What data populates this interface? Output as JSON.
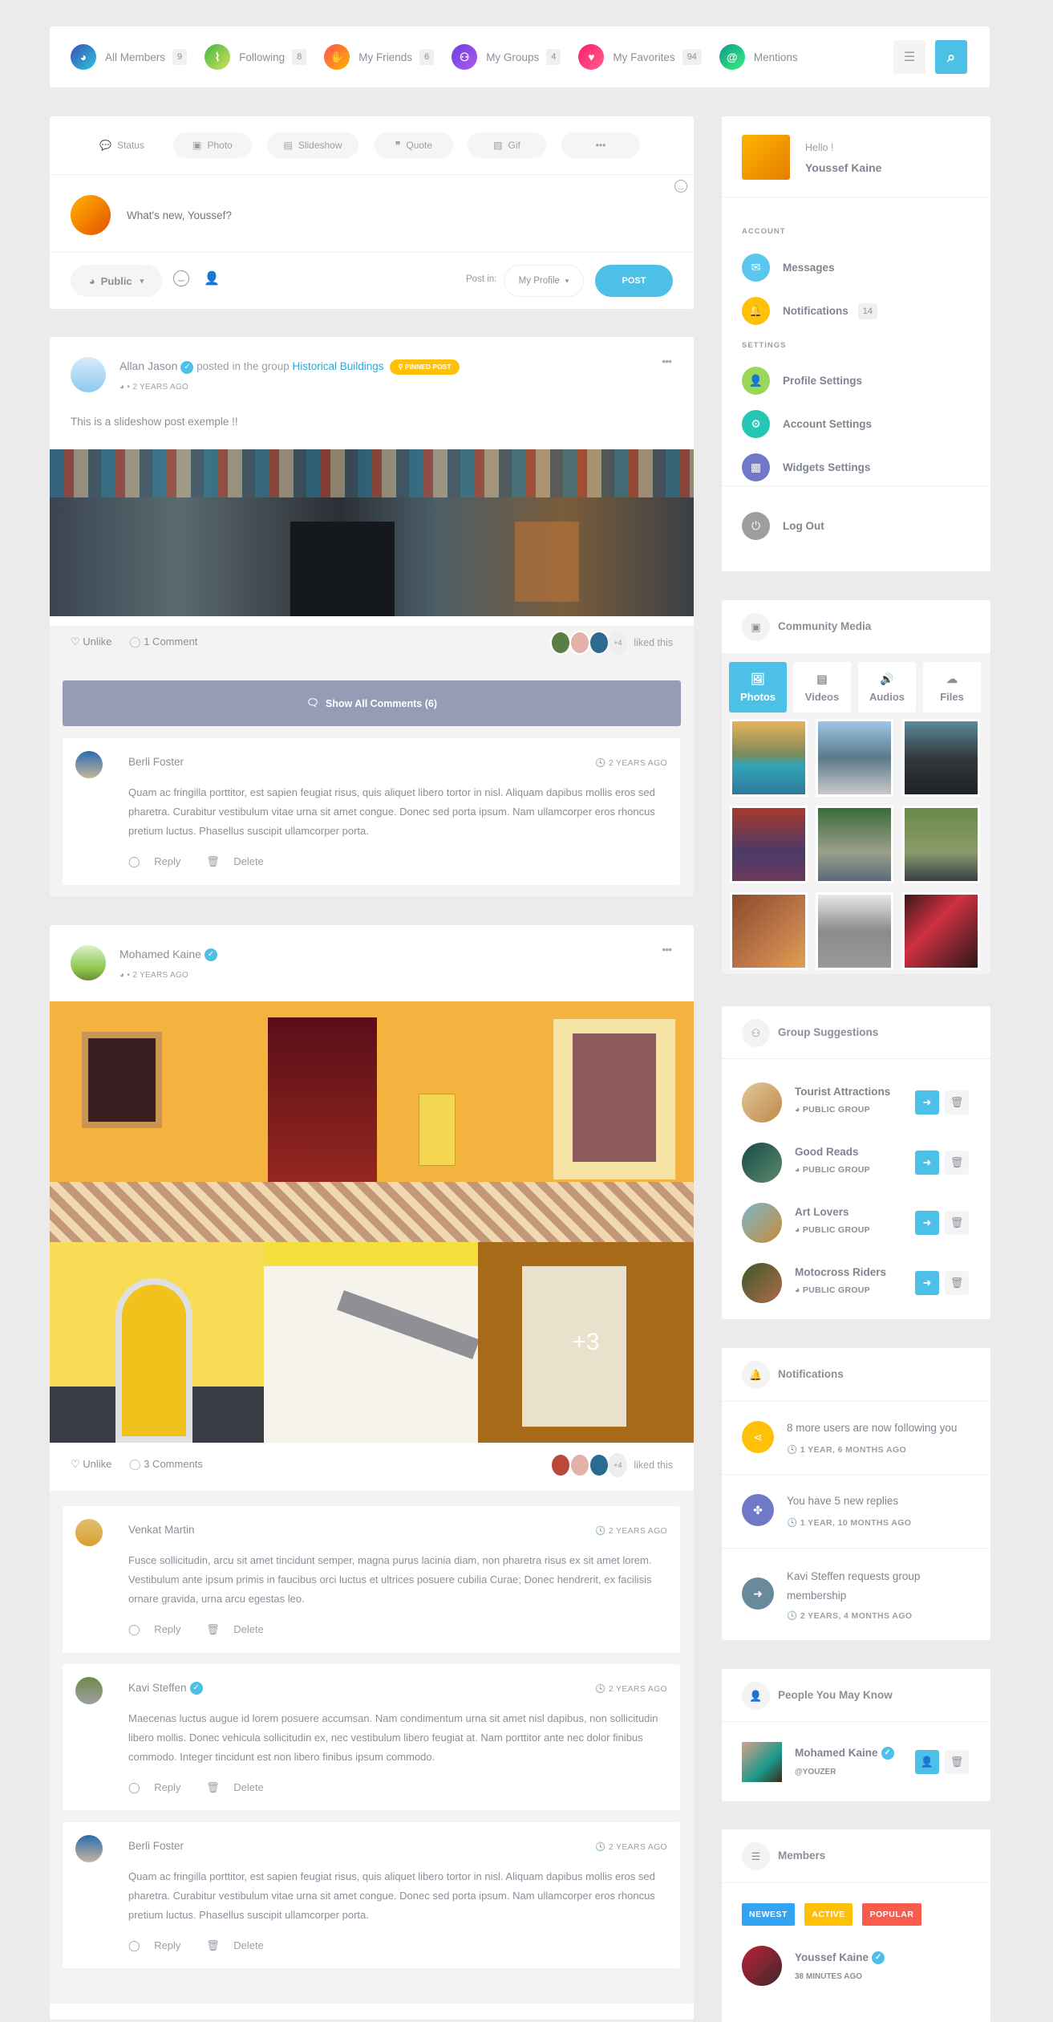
{
  "topnav": {
    "items": [
      {
        "label": "All Members",
        "count": "9",
        "icon": "globe-icon",
        "glyph": "◕"
      },
      {
        "label": "Following",
        "count": "8",
        "icon": "rss-icon",
        "glyph": "⌇"
      },
      {
        "label": "My Friends",
        "count": "6",
        "icon": "handshake-icon",
        "glyph": "✋"
      },
      {
        "label": "My Groups",
        "count": "4",
        "icon": "users-icon",
        "glyph": "⚇"
      },
      {
        "label": "My Favorites",
        "count": "94",
        "icon": "heart-icon",
        "glyph": "♥"
      },
      {
        "label": "Mentions",
        "count": "",
        "icon": "at-icon",
        "glyph": "@"
      }
    ],
    "filter_glyph": "☰",
    "search_glyph": "⌕"
  },
  "composer": {
    "tabs": [
      {
        "label": "Status",
        "glyph": "💬"
      },
      {
        "label": "Photo",
        "glyph": "▣"
      },
      {
        "label": "Slideshow",
        "glyph": "▤"
      },
      {
        "label": "Quote",
        "glyph": "❞"
      },
      {
        "label": "Gif",
        "glyph": "▨"
      },
      {
        "label": "•••",
        "glyph": ""
      }
    ],
    "placeholder": "What's new, Youssef?",
    "privacy": "Public",
    "post_in_label": "Post in:",
    "post_in_value": "My Profile",
    "post_button": "POST"
  },
  "posts": [
    {
      "author": "Allan Jason",
      "action": "posted in the group",
      "group": "Historical Buildings",
      "badge": "PINNED POST",
      "time": "2 YEARS AGO",
      "text": "This is a slideshow post exemple !!",
      "like_label": "Unlike",
      "comment_count_label": "1 Comment",
      "likers_extra": "+4",
      "liked_this": "liked this",
      "show_all": "Show All Comments (6)",
      "comments": [
        {
          "name": "Berli Foster",
          "verified": false,
          "time": "2 YEARS AGO",
          "text": "Quam ac fringilla porttitor, est sapien feugiat risus, quis aliquet libero tortor in nisl. Aliquam dapibus mollis eros sed pharetra. Curabitur vestibulum vitae urna sit amet congue. Donec sed porta ipsum. Nam ullamcorper eros rhoncus pretium luctus. Phasellus suscipit ullamcorper porta.",
          "reply": "Reply",
          "delete": "Delete"
        }
      ]
    },
    {
      "author": "Mohamed Kaine",
      "time": "2 YEARS AGO",
      "more_photos": "+3",
      "like_label": "Unlike",
      "comment_count_label": "3 Comments",
      "likers_extra": "+4",
      "liked_this": "liked this",
      "comments": [
        {
          "name": "Venkat Martin",
          "verified": false,
          "time": "2 YEARS AGO",
          "text": "Fusce sollicitudin, arcu sit amet tincidunt semper, magna purus lacinia diam, non pharetra risus ex sit amet lorem. Vestibulum ante ipsum primis in faucibus orci luctus et ultrices posuere cubilia Curae; Donec hendrerit, ex facilisis ornare gravida, urna arcu egestas leo.",
          "reply": "Reply",
          "delete": "Delete"
        },
        {
          "name": "Kavi Steffen",
          "verified": true,
          "time": "2 YEARS AGO",
          "text": "Maecenas luctus augue id lorem posuere accumsan. Nam condimentum urna sit amet nisl dapibus, non sollicitudin libero mollis. Donec vehicula sollicitudin ex, nec vestibulum libero feugiat at. Nam porttitor ante nec dolor finibus commodo. Integer tincidunt est non libero finibus ipsum commodo.",
          "reply": "Reply",
          "delete": "Delete"
        },
        {
          "name": "Berli Foster",
          "verified": false,
          "time": "2 YEARS AGO",
          "text": "Quam ac fringilla porttitor, est sapien feugiat risus, quis aliquet libero tortor in nisl. Aliquam dapibus mollis eros sed pharetra. Curabitur vestibulum vitae urna sit amet congue. Donec sed porta ipsum. Nam ullamcorper eros rhoncus pretium luctus. Phasellus suscipit ullamcorper porta.",
          "reply": "Reply",
          "delete": "Delete"
        }
      ]
    }
  ],
  "account_widget": {
    "greeting": "Hello !",
    "name": "Youssef Kaine",
    "account_label": "ACCOUNT",
    "settings_label": "SETTINGS",
    "items": [
      {
        "label": "Messages",
        "color": "#5bc7ee",
        "glyph": "✉"
      },
      {
        "label": "Notifications",
        "color": "#ffc107",
        "glyph": "🔔",
        "count": "14"
      },
      {
        "label": "Profile Settings",
        "color": "#9ad65a",
        "glyph": "👤"
      },
      {
        "label": "Account Settings",
        "color": "#26c6b4",
        "glyph": "⚙"
      },
      {
        "label": "Widgets Settings",
        "color": "#7079c7",
        "glyph": "▦"
      }
    ],
    "logout": {
      "label": "Log Out",
      "color": "#9e9e9e",
      "glyph": "⏻"
    }
  },
  "media_widget": {
    "title": "Community Media",
    "tabs": [
      {
        "label": "Photos",
        "glyph": "🖼"
      },
      {
        "label": "Videos",
        "glyph": "▤"
      },
      {
        "label": "Audios",
        "glyph": "🔊"
      },
      {
        "label": "Files",
        "glyph": "☁"
      }
    ]
  },
  "groups_widget": {
    "title": "Group Suggestions",
    "groups": [
      {
        "name": "Tourist Attractions",
        "type": "PUBLIC GROUP"
      },
      {
        "name": "Good Reads",
        "type": "PUBLIC GROUP"
      },
      {
        "name": "Art Lovers",
        "type": "PUBLIC GROUP"
      },
      {
        "name": "Motocross Riders",
        "type": "PUBLIC GROUP"
      }
    ]
  },
  "notifications_widget": {
    "title": "Notifications",
    "items": [
      {
        "text": "8 more users are now following you",
        "time": "1 YEAR, 6 MONTHS AGO",
        "color": "#ffc107",
        "glyph": "⋖"
      },
      {
        "text": "You have 5 new replies",
        "time": "1 YEAR, 10 MONTHS AGO",
        "color": "#7079c7",
        "glyph": "✤"
      },
      {
        "text": "Kavi Steffen requests group membership",
        "time": "2 YEARS, 4 MONTHS AGO",
        "color": "#698a9b",
        "glyph": "➜"
      }
    ]
  },
  "people_widget": {
    "title": "People You May Know",
    "person": {
      "name": "Mohamed Kaine",
      "handle": "@YOUZER"
    }
  },
  "members_widget": {
    "title": "Members",
    "tabs": [
      {
        "label": "NEWEST",
        "color": "#33a3f4"
      },
      {
        "label": "ACTIVE",
        "color": "#ffc107"
      },
      {
        "label": "POPULAR",
        "color": "#fa5b4f"
      }
    ],
    "member": {
      "name": "Youssef Kaine",
      "time": "38 MINUTES AGO"
    }
  }
}
